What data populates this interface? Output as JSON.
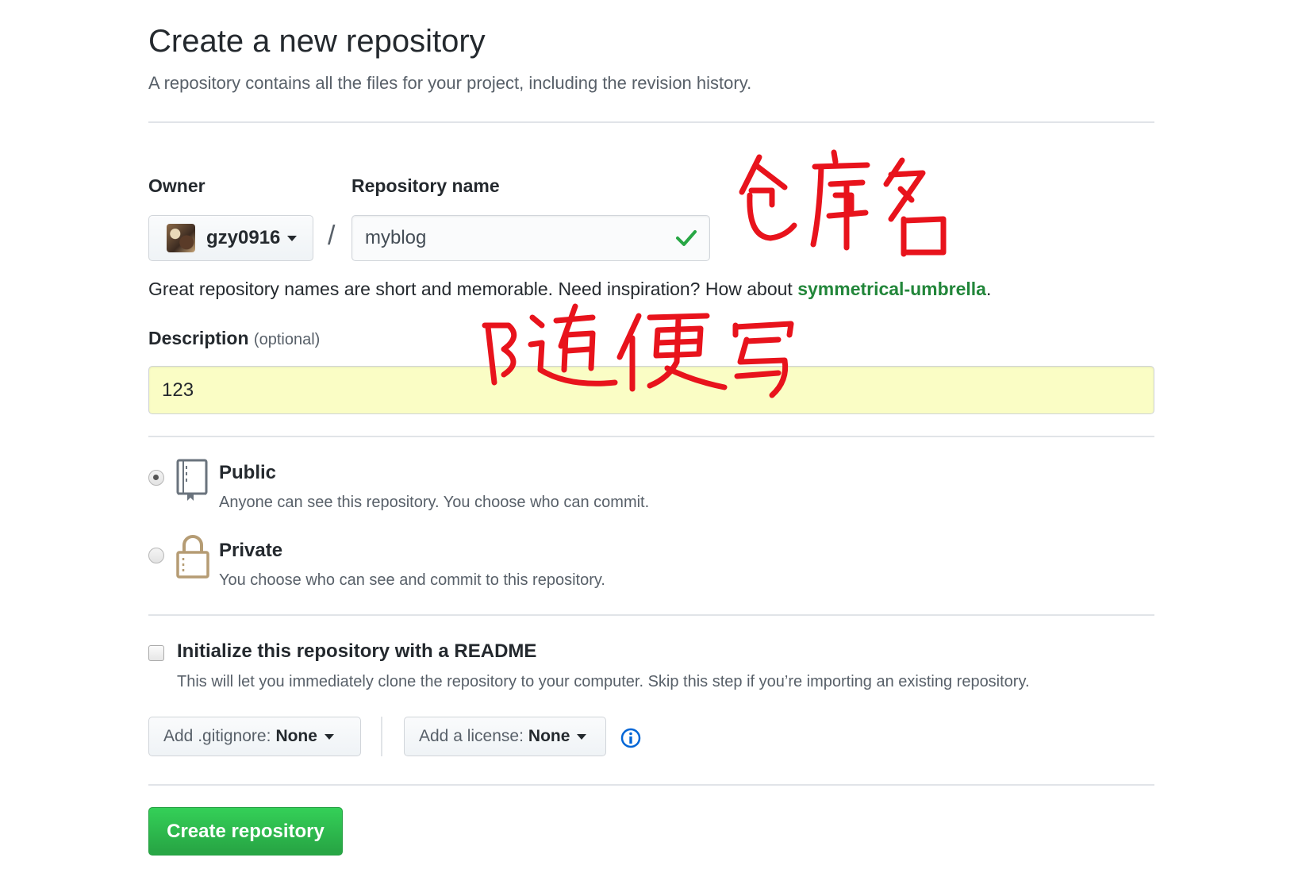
{
  "header": {
    "title": "Create a new repository",
    "subtitle": "A repository contains all the files for your project, including the revision history."
  },
  "owner": {
    "label": "Owner",
    "value": "gzy0916"
  },
  "separator": "/",
  "repo_name": {
    "label": "Repository name",
    "value": "myblog",
    "valid_icon": "check-icon"
  },
  "name_hint": {
    "prefix": "Great repository names are short and memorable. Need inspiration? How about ",
    "suggestion": "symmetrical-umbrella",
    "suffix": "."
  },
  "description": {
    "label": "Description",
    "optional": "(optional)",
    "value": "123"
  },
  "visibility": {
    "selected": "public",
    "public": {
      "title": "Public",
      "description": "Anyone can see this repository. You choose who can commit.",
      "icon": "repo-icon"
    },
    "private": {
      "title": "Private",
      "description": "You choose who can see and commit to this repository.",
      "icon": "lock-icon"
    }
  },
  "readme": {
    "checked": false,
    "title": "Initialize this repository with a README",
    "description": "This will let you immediately clone the repository to your computer. Skip this step if you’re importing an existing repository."
  },
  "gitignore": {
    "label": "Add .gitignore:",
    "value": "None"
  },
  "license": {
    "label": "Add a license:",
    "value": "None",
    "info_icon": "info-icon"
  },
  "submit": {
    "label": "Create repository"
  },
  "annotations": {
    "color": "#e8131c"
  },
  "colors": {
    "accent_green": "#28a745",
    "suggestion_green": "#22863a",
    "description_bg": "#fafdc5",
    "info_blue": "#0366d6"
  }
}
